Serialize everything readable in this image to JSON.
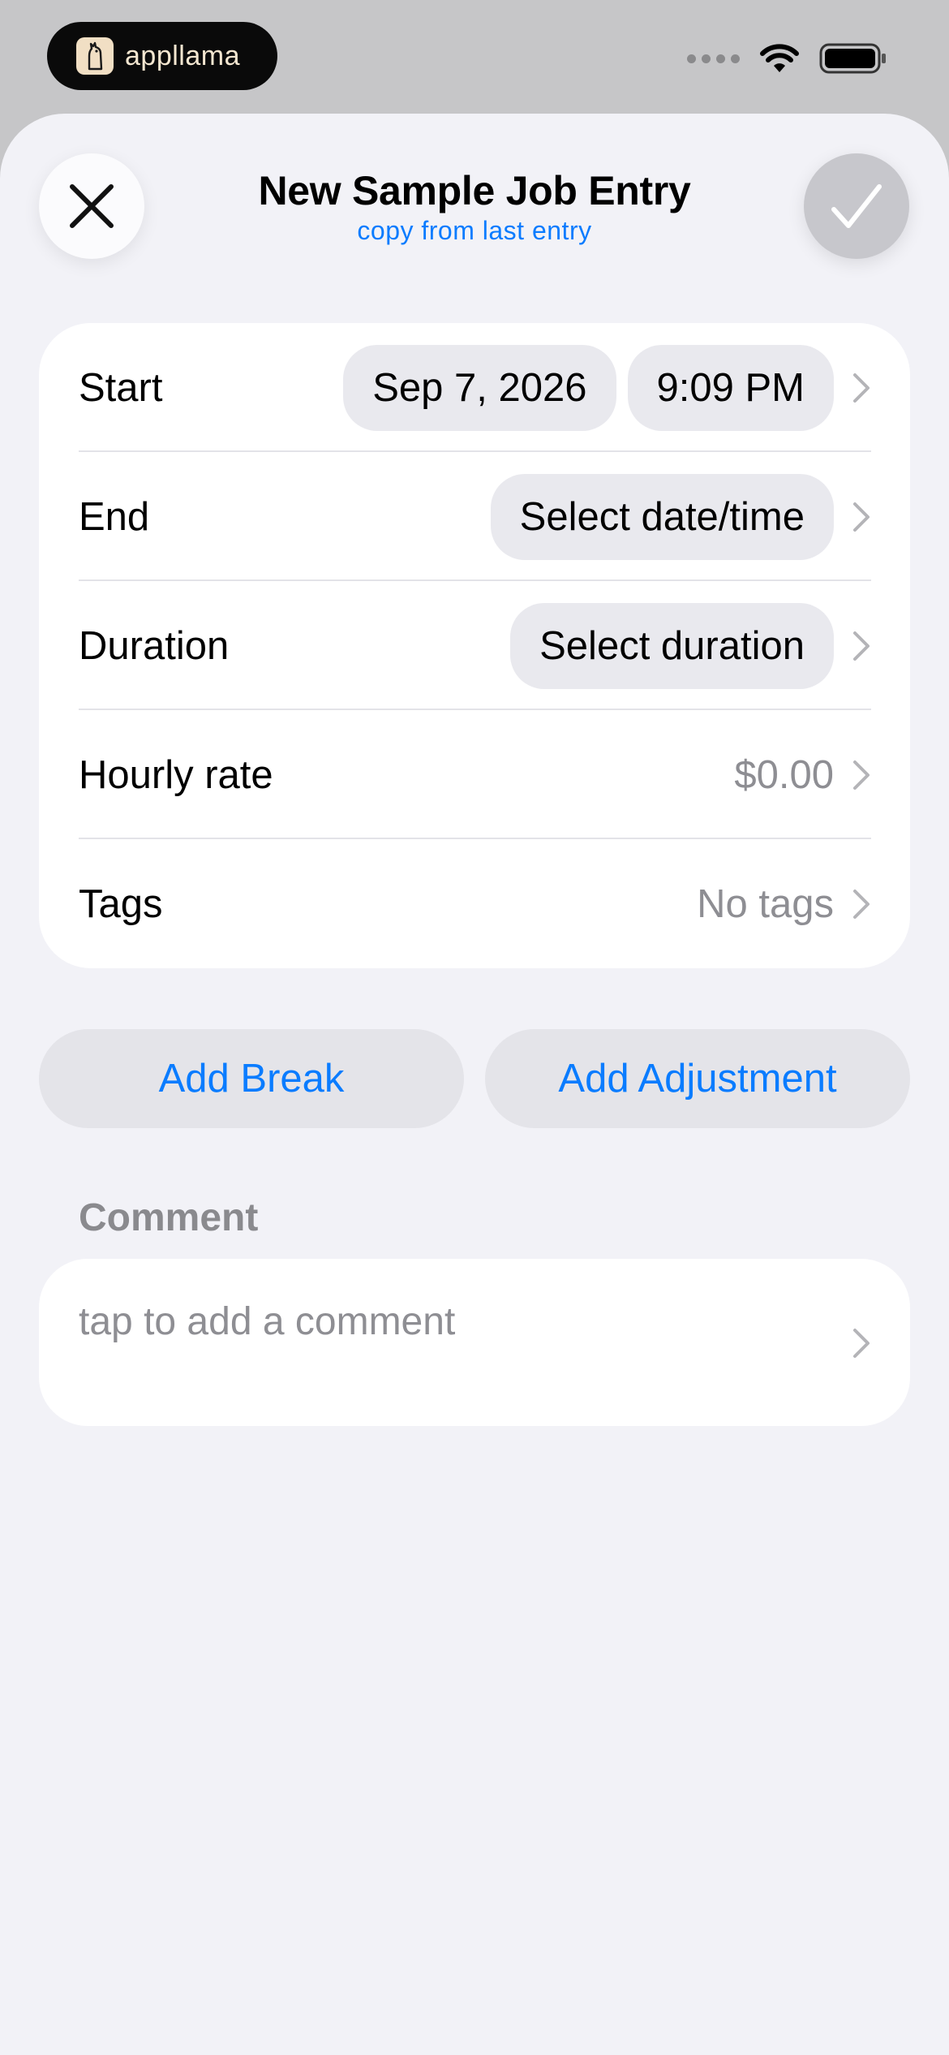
{
  "status_bar": {
    "brand_name": "appllama",
    "icons": [
      "signal-dots-icon",
      "wifi-icon",
      "battery-icon"
    ]
  },
  "header": {
    "title": "New Sample Job Entry",
    "subtitle": "copy from last entry",
    "close_icon": "close-icon",
    "confirm_icon": "checkmark-icon"
  },
  "form": {
    "start": {
      "label": "Start",
      "date": "Sep 7, 2026",
      "time": "9:09 PM"
    },
    "end": {
      "label": "End",
      "value": "Select date/time"
    },
    "duration": {
      "label": "Duration",
      "value": "Select duration"
    },
    "hourly_rate": {
      "label": "Hourly rate",
      "value": "$0.00"
    },
    "tags": {
      "label": "Tags",
      "value": "No tags"
    }
  },
  "actions": {
    "add_break": "Add Break",
    "add_adjustment": "Add Adjustment"
  },
  "comment": {
    "section_label": "Comment",
    "placeholder": "tap to add a comment"
  },
  "colors": {
    "accent": "#0a7cff",
    "background": "#f2f2f7",
    "card": "#ffffff",
    "chip": "#e9e9ee",
    "secondary_text": "#8e8e93"
  }
}
